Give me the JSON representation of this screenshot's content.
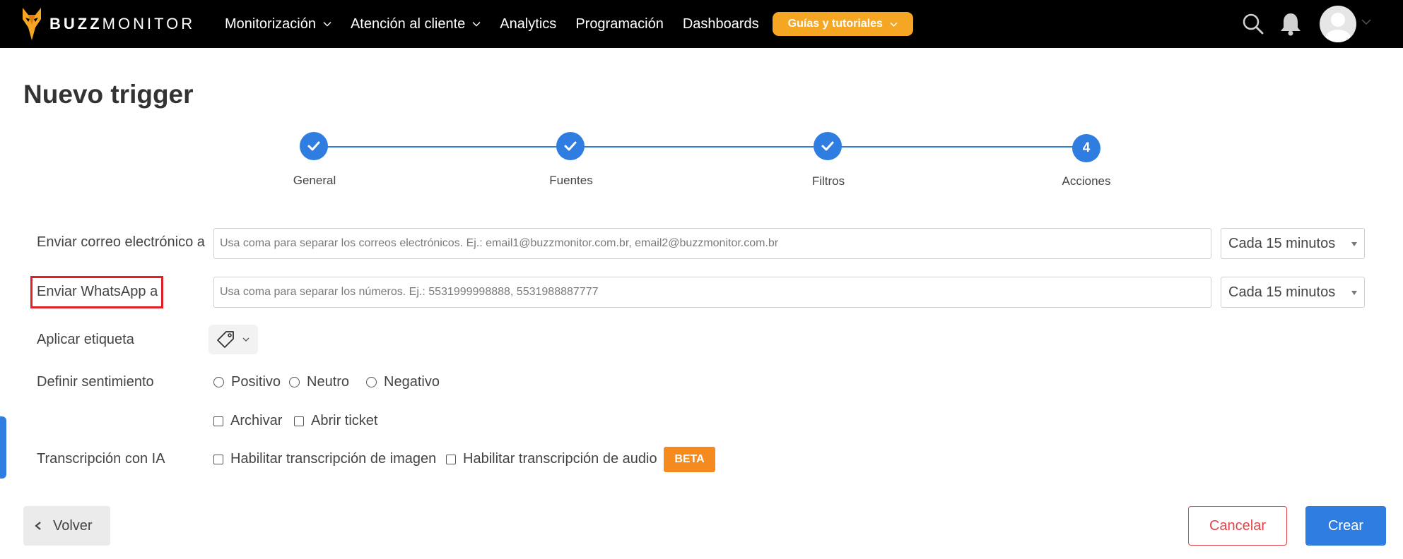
{
  "app": {
    "brand_bold": "BUZZ",
    "brand_light": "MONITOR"
  },
  "nav": {
    "items": [
      {
        "label": "Monitorización",
        "has_dropdown": true
      },
      {
        "label": "Atención al cliente",
        "has_dropdown": true
      },
      {
        "label": "Analytics",
        "has_dropdown": false
      },
      {
        "label": "Programación",
        "has_dropdown": false
      },
      {
        "label": "Dashboards",
        "has_dropdown": false
      }
    ],
    "guides_label": "Guías y tutoriales",
    "icons": [
      "search-icon",
      "bell-icon",
      "avatar",
      "chevron-down-icon"
    ]
  },
  "page": {
    "title": "Nuevo trigger"
  },
  "stepper": {
    "steps": [
      {
        "label": "General",
        "state": "done"
      },
      {
        "label": "Fuentes",
        "state": "done"
      },
      {
        "label": "Filtros",
        "state": "done"
      },
      {
        "label": "Acciones",
        "state": "current",
        "number": "4"
      }
    ]
  },
  "form": {
    "email": {
      "label": "Enviar correo electrónico a",
      "placeholder": "Usa coma para separar los correos electrónicos. Ej.: email1@buzzmonitor.com.br, email2@buzzmonitor.com.br",
      "frequency": "Cada 15 minutos"
    },
    "whatsapp": {
      "label": "Enviar WhatsApp a",
      "placeholder": "Usa coma para separar los números. Ej.: 5531999998888, 5531988887777",
      "frequency": "Cada 15 minutos"
    },
    "tag": {
      "label": "Aplicar etiqueta"
    },
    "sentiment": {
      "label": "Definir sentimiento",
      "options": [
        "Positivo",
        "Neutro",
        "Negativo"
      ]
    },
    "actions": {
      "archive": "Archivar",
      "open_ticket": "Abrir ticket"
    },
    "transcription": {
      "label": "Transcripción con IA",
      "image": "Habilitar transcripción de imagen",
      "audio": "Habilitar transcripción de audio",
      "badge": "BETA"
    }
  },
  "footer": {
    "back": "Volver",
    "cancel": "Cancelar",
    "create": "Crear"
  },
  "colors": {
    "primary": "#2f7de1",
    "accent": "#f5a623",
    "beta": "#f58b1f",
    "danger": "#e0454c",
    "highlight": "#e01f26"
  }
}
